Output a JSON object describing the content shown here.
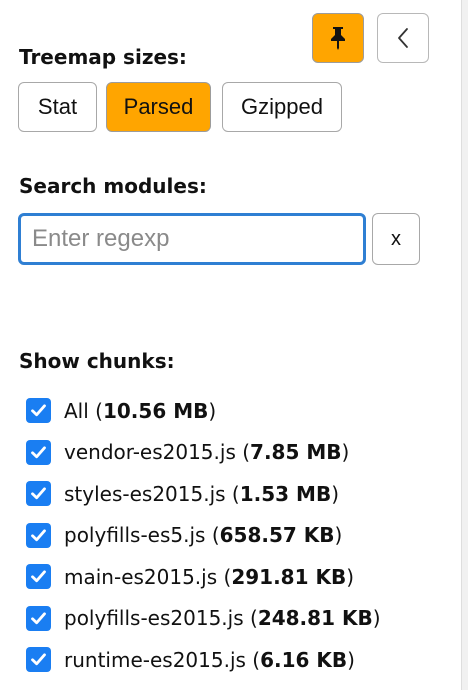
{
  "toolbar": {
    "pin_icon": "pin-icon",
    "collapse_icon": "chevron-left-icon",
    "pin_active": true
  },
  "treemap": {
    "title": "Treemap sizes:",
    "options": [
      {
        "label": "Stat",
        "active": false
      },
      {
        "label": "Parsed",
        "active": true
      },
      {
        "label": "Gzipped",
        "active": false
      }
    ]
  },
  "search": {
    "title": "Search modules:",
    "value": "",
    "placeholder": "Enter regexp",
    "clear_label": "x"
  },
  "chunks": {
    "title": "Show chunks:",
    "items": [
      {
        "name": "All",
        "size": "10.56 MB",
        "checked": true
      },
      {
        "name": "vendor-es2015.js",
        "size": "7.85 MB",
        "checked": true
      },
      {
        "name": "styles-es2015.js",
        "size": "1.53 MB",
        "checked": true
      },
      {
        "name": "polyfills-es5.js",
        "size": "658.57 KB",
        "checked": true
      },
      {
        "name": "main-es2015.js",
        "size": "291.81 KB",
        "checked": true
      },
      {
        "name": "polyfills-es2015.js",
        "size": "248.81 KB",
        "checked": true
      },
      {
        "name": "runtime-es2015.js",
        "size": "6.16 KB",
        "checked": true
      }
    ]
  },
  "colors": {
    "accent": "#ffa500",
    "checkbox": "#1a7ef2",
    "focus_border": "#2f7fd3"
  }
}
